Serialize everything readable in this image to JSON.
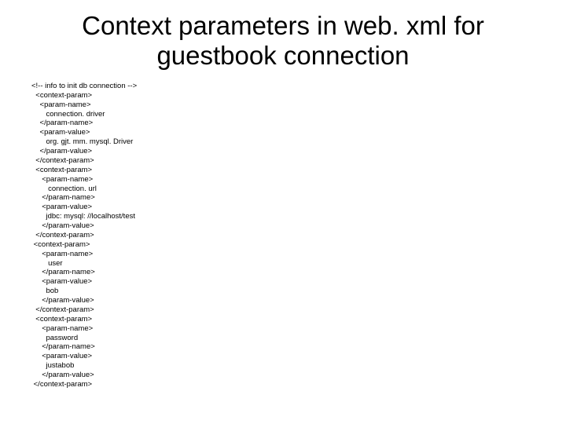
{
  "title_line1": "Context parameters in web. xml for",
  "title_line2": "guestbook connection",
  "code": "<!-- info to init db connection -->\n  <context-param>\n    <param-name>\n       connection. driver\n    </param-name>\n    <param-value>\n       org. gjt. mm. mysql. Driver\n    </param-value>\n  </context-param>\n  <context-param>\n     <param-name>\n        connection. url\n     </param-name>\n     <param-value>\n       jdbc: mysql: //localhost/test\n     </param-value>\n  </context-param>\n <context-param>\n     <param-name>\n        user\n     </param-name>\n     <param-value>\n       bob\n     </param-value>\n  </context-param>\n  <context-param>\n     <param-name>\n       password\n     </param-name>\n     <param-value>\n       justabob\n     </param-value>\n </context-param>"
}
